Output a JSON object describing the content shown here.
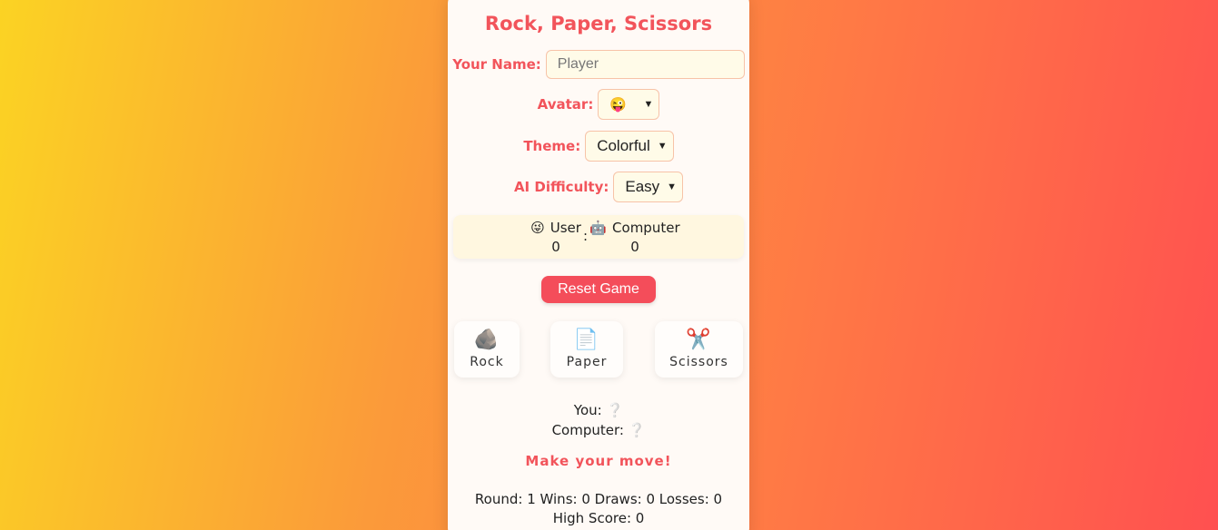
{
  "title": "Rock, Paper, Scissors",
  "form": {
    "name_label": "Your Name:",
    "name_placeholder": "Player",
    "avatar_label": "Avatar:",
    "avatar_value": "😜",
    "theme_label": "Theme:",
    "theme_value": "Colorful",
    "difficulty_label": "AI Difficulty:",
    "difficulty_value": "Easy"
  },
  "scoreboard": {
    "user_avatar": "😜",
    "user_label": "User",
    "user_score": "0",
    "separator": ":",
    "computer_avatar": "🤖",
    "computer_label": "Computer",
    "computer_score": "0"
  },
  "reset_label": "Reset Game",
  "choices": [
    {
      "icon": "🪨",
      "label": "Rock"
    },
    {
      "icon": "📄",
      "label": "Paper"
    },
    {
      "icon": "✂️",
      "label": "Scissors"
    }
  ],
  "result": {
    "you_label": "You:",
    "you_value": "❔",
    "computer_label": "Computer:",
    "computer_value": "❔"
  },
  "message": "Make your move!",
  "stats": "Round: 1 Wins: 0 Draws: 0 Losses: 0 High Score: 0",
  "colors": {
    "accent": "#f2545b",
    "button": "#f44d5a",
    "panel": "#fffaf6"
  }
}
